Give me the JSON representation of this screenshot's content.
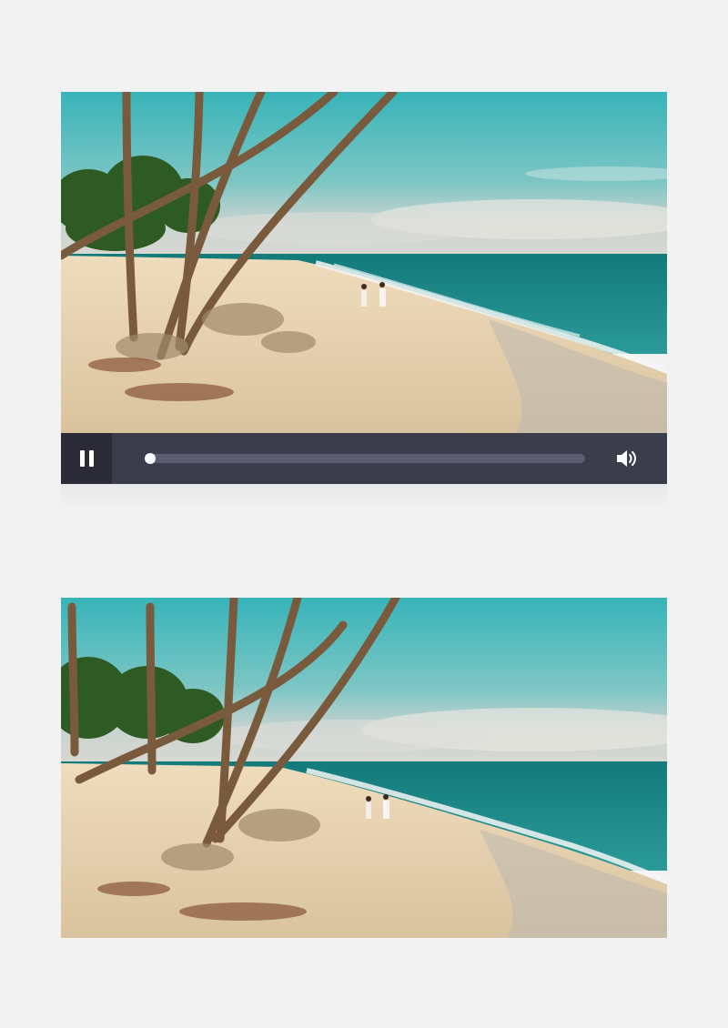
{
  "player": {
    "state": "playing",
    "progress": 0,
    "controls": {
      "pause_icon": "pause-icon",
      "volume_icon": "speaker-volume-icon"
    }
  },
  "scene": {
    "sky_color": "#3fb6b6",
    "sea_color": "#1e8a86",
    "sand_color": "#e2cfae",
    "control_bar_color": "#3b3d4d"
  }
}
